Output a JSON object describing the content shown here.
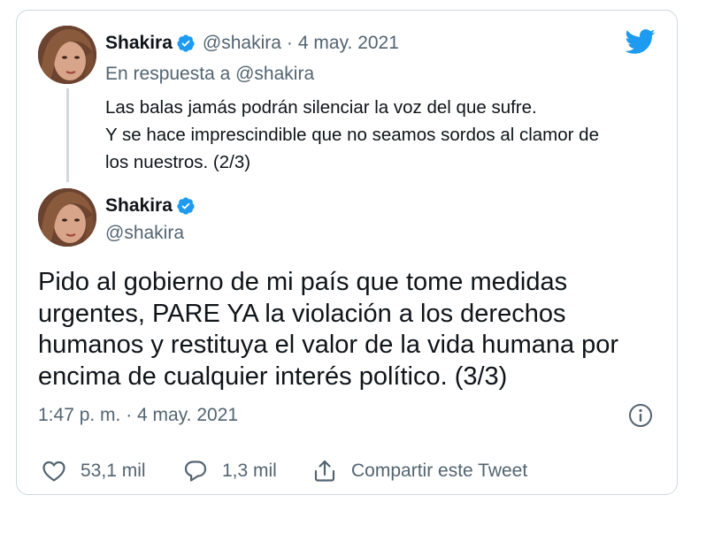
{
  "quoted_tweet": {
    "author_name": "Shakira",
    "author_handle": "@shakira",
    "separator": "·",
    "date": "4 may. 2021",
    "reply_prefix": "En respuesta a",
    "reply_handle": "@shakira",
    "text_lines": [
      "Las balas jamás podrán silenciar la voz del que sufre.",
      "Y se hace imprescindible que no seamos sordos al clamor de",
      "los nuestros. (2/3)"
    ]
  },
  "main_tweet": {
    "author_name": "Shakira",
    "author_handle": "@shakira",
    "text_lines": [
      "Pido al gobierno de mi país que tome medidas",
      "urgentes, PARE YA la violación a los derechos",
      "humanos y restituya el valor de la vida humana por",
      "encima de cualquier interés político. (3/3)"
    ],
    "timestamp": "1:47 p. m. · 4 may. 2021"
  },
  "actions": {
    "like_count": "53,1 mil",
    "reply_count": "1,3 mil",
    "share_label": "Compartir este Tweet"
  },
  "icons": {
    "brand": "twitter-bird-icon",
    "verified": "verified-badge-icon",
    "info": "info-icon",
    "like": "heart-icon",
    "reply": "speech-bubble-icon",
    "share": "share-icon"
  },
  "colors": {
    "twitter_blue": "#1d9bf0",
    "text_primary": "#0f1419",
    "text_secondary": "#536471",
    "border": "#cfd9de"
  }
}
